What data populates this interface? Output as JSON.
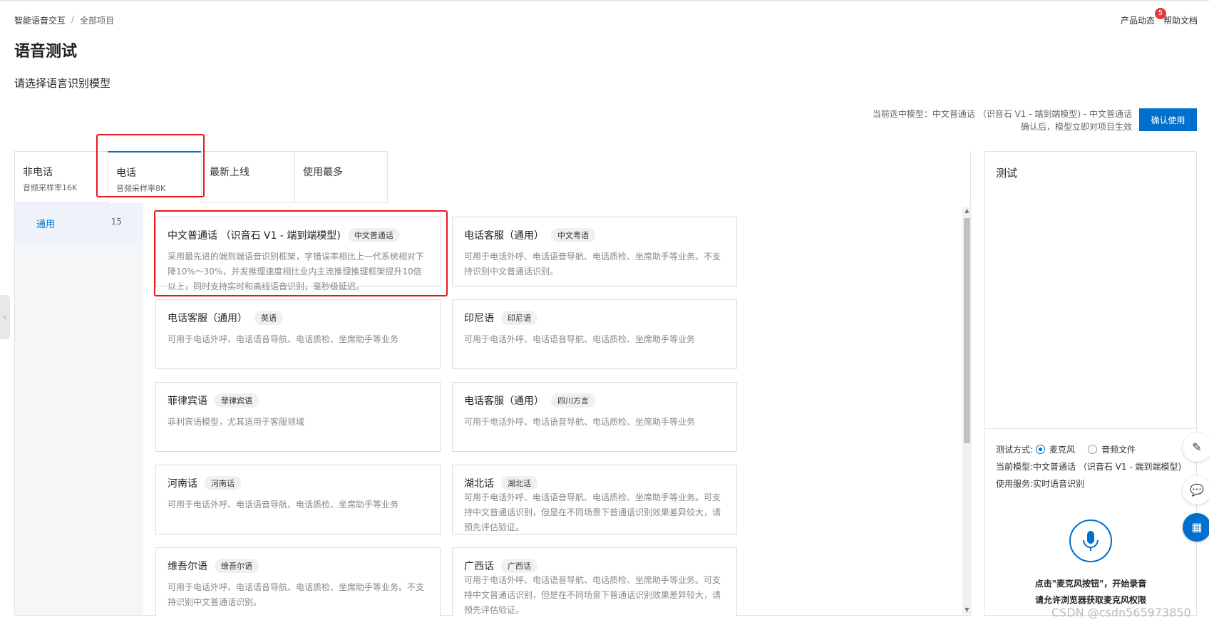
{
  "breadcrumb": {
    "root": "智能语音交互",
    "sep": "/",
    "current": "全部项目"
  },
  "topbar": {
    "news": "产品动态",
    "news_badge": "5",
    "docs": "帮助文档"
  },
  "page": {
    "title": "语音测试",
    "subtitle": "请选择语言识别模型"
  },
  "current_model": {
    "line1": "当前选中模型：中文普通话 （识音石 V1 - 端到端模型) - 中文普通话",
    "line2": "确认后，模型立即对项目生效",
    "confirm_button": "确认使用"
  },
  "tabs": [
    {
      "label": "非电话",
      "sub": "音频采样率16K"
    },
    {
      "label": "电话",
      "sub": "音频采样率8K"
    },
    {
      "label": "最新上线",
      "sub": ""
    },
    {
      "label": "使用最多",
      "sub": ""
    }
  ],
  "category": {
    "name": "通用",
    "count": "15"
  },
  "cards": [
    {
      "title": "中文普通话 （识音石 V1 - 端到端模型)",
      "tag": "中文普通话",
      "desc": "采用最先进的端到端语音识别框架，字错误率相比上一代系统相对下降10%～30%，并发推理速度相比业内主流推理推理框架提升10倍以上，同时支持实时和离线语音识别，毫秒级延迟。"
    },
    {
      "title": "电话客服（通用）",
      "tag": "中文粤语",
      "desc": "可用于电话外呼、电话语音导航、电话质检、坐席助手等业务。不支持识别中文普通话识别。"
    },
    {
      "title": "电话客服（通用）",
      "tag": "英语",
      "desc": "可用于电话外呼、电话语音导航、电话质检、坐席助手等业务"
    },
    {
      "title": "印尼语",
      "tag": "印尼语",
      "desc": "可用于电话外呼、电话语音导航、电话质检、坐席助手等业务"
    },
    {
      "title": "菲律宾语",
      "tag": "菲律宾语",
      "desc": "菲利宾语模型，尤其适用于客服领域"
    },
    {
      "title": "电话客服（通用）",
      "tag": "四川方言",
      "desc": "可用于电话外呼、电话语音导航、电话质检、坐席助手等业务"
    },
    {
      "title": "河南话",
      "tag": "河南话",
      "desc": "可用于电话外呼、电话语音导航、电话质检、坐席助手等业务"
    },
    {
      "title": "湖北话",
      "tag": "湖北话",
      "desc": "可用于电话外呼、电话语音导航、电话质检、坐席助手等业务。可支持中文普通话识别，但是在不同场景下普通话识别效果差异较大，请预先评估验证。"
    },
    {
      "title": "维吾尔语",
      "tag": "维吾尔语",
      "desc": "可用于电话外呼、电话语音导航、电话质检、坐席助手等业务。不支持识别中文普通话识别。"
    },
    {
      "title": "广西话",
      "tag": "广西话",
      "desc": "可用于电话外呼、电话语音导航、电话质检、坐席助手等业务。可支持中文普通话识别，但是在不同场景下普通话识别效果差异较大，请预先评估验证。"
    }
  ],
  "test": {
    "title": "测试",
    "mode_label": "测试方式:",
    "mode_mic": "麦克风",
    "mode_file": "音频文件",
    "model_label": "当前模型:",
    "model_value": "中文普通话 （识音石 V1 - 端到端模型)",
    "service_label": "使用服务:",
    "service_value": "实时语音识别",
    "hint1": "点击\"麦克风按钮\"，开始录音",
    "hint2": "请允许浏览器获取麦克风权限"
  },
  "watermark": "CSDN @csdn565973850",
  "colors": {
    "accent": "#0070cc",
    "highlight": "#e8191c",
    "badge": "#e4393c"
  }
}
